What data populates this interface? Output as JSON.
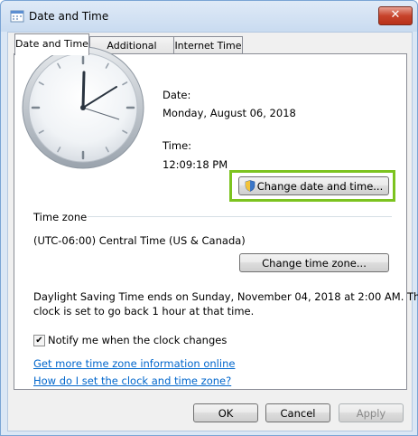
{
  "window": {
    "title": "Date and Time",
    "close_glyph": "✕"
  },
  "tabs": [
    {
      "label": "Date and Time",
      "active": true
    },
    {
      "label": "Additional Clocks",
      "active": false
    },
    {
      "label": "Internet Time",
      "active": false
    }
  ],
  "date_section": {
    "date_label": "Date:",
    "date_value": "Monday, August 06, 2018",
    "time_label": "Time:",
    "time_value": "12:09:18 PM"
  },
  "buttons": {
    "change_date_time": "Change date and time...",
    "change_time_zone": "Change time zone...",
    "ok": "OK",
    "cancel": "Cancel",
    "apply": "Apply"
  },
  "time_zone": {
    "heading": "Time zone",
    "value": "(UTC-06:00) Central Time (US & Canada)"
  },
  "dst_notice": {
    "line1": "Daylight Saving Time ends on Sunday, November 04, 2018 at 2:00 AM. The",
    "line2": "clock is set to go back 1 hour at that time."
  },
  "notify": {
    "label": "Notify me when the clock changes",
    "checked": true,
    "check_glyph": "✔"
  },
  "links": {
    "more_info": "Get more time zone information online",
    "how_to": "How do I set the clock and time zone?"
  },
  "colors": {
    "highlight": "#7cc31f",
    "link": "#0066cc"
  }
}
